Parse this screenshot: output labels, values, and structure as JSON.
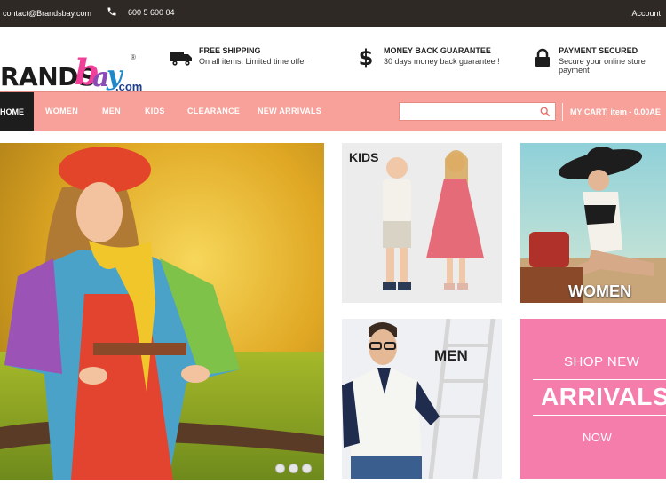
{
  "topbar": {
    "email": "contact@Brandsbay.com",
    "phone": "600 5 600 04",
    "account": "Account"
  },
  "logo": {
    "brands": "RANDS",
    "bay_b": "b",
    "bay_a": "a",
    "bay_y": "y",
    "reg": "®",
    "com": ".com"
  },
  "features": [
    {
      "icon": "truck-icon",
      "title": "FREE SHIPPING",
      "subtitle": "On all items. Limited time offer"
    },
    {
      "icon": "dollar-icon",
      "title": "MONEY BACK GUARANTEE",
      "subtitle": "30 days money back guarantee !"
    },
    {
      "icon": "lock-icon",
      "title": "PAYMENT SECURED",
      "subtitle": "Secure your online store payment"
    }
  ],
  "nav": {
    "home": "HOME",
    "items": [
      "WOMEN",
      "MEN",
      "KIDS",
      "CLEARANCE",
      "NEW ARRIVALS"
    ],
    "search_placeholder": "",
    "cart": "MY CART:  item  -  0.00AE"
  },
  "tiles": {
    "kids": "KIDS",
    "women": "WOMEN",
    "men": "MEN",
    "arrivals_top": "SHOP NEW",
    "arrivals_main": "ARRIVALS",
    "arrivals_bottom": "NOW"
  },
  "colors": {
    "topbar": "#2e2924",
    "nav": "#f7a19a",
    "arrivals": "#f47dac",
    "brand_pink": "#f0409a"
  },
  "slider": {
    "slides": 3,
    "active": 1
  }
}
